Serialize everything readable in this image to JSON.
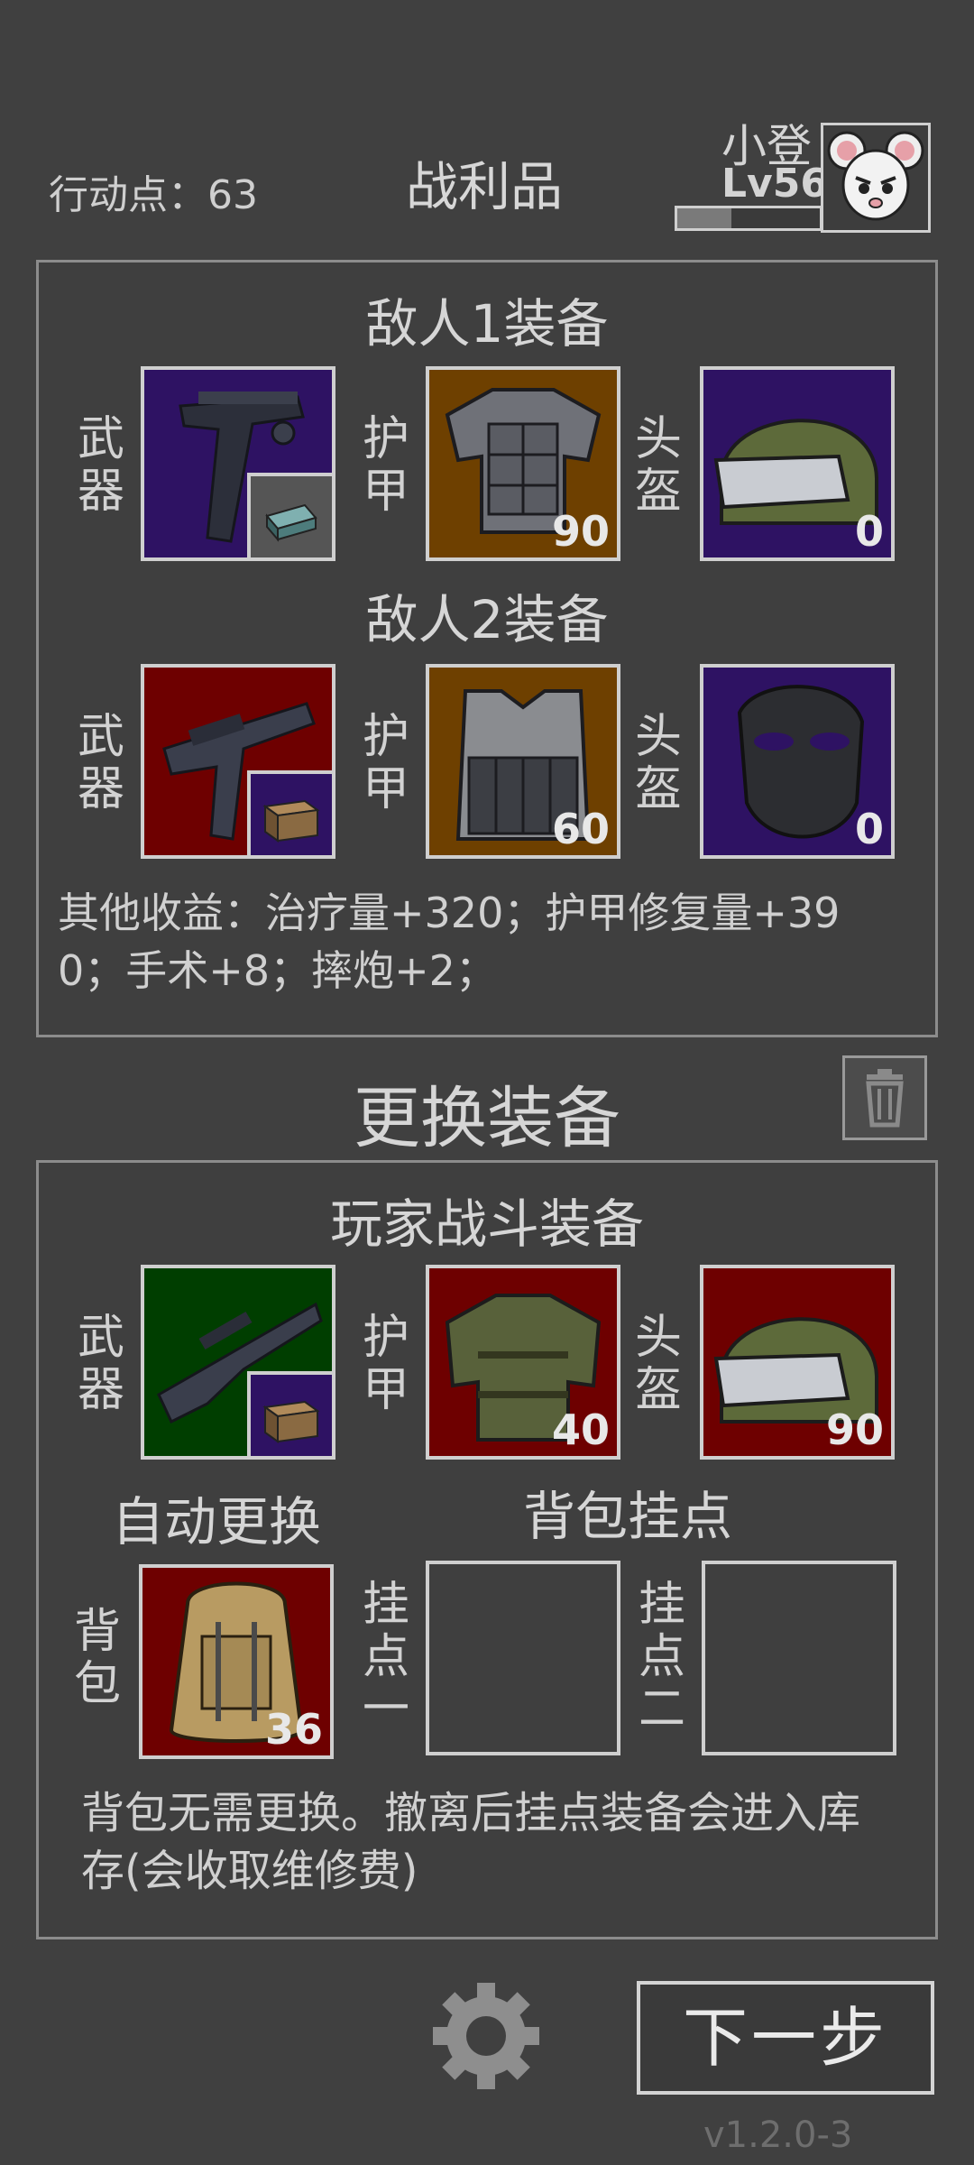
{
  "header": {
    "action_points": "行动点：63",
    "title": "战利品",
    "player_name": "小登",
    "player_level": "Lv56",
    "xp_progress": 0.38
  },
  "loot": {
    "enemy1_title": "敌人1装备",
    "enemy2_title": "敌人2装备",
    "labels": {
      "weapon": "武器",
      "armor": "护甲",
      "helmet": "头盔"
    },
    "enemy1": {
      "armor_durability": "90",
      "helmet_durability": "0"
    },
    "enemy2": {
      "armor_durability": "60",
      "helmet_durability": "0"
    },
    "other_gains_line1": "其他收益：治疗量+320；护甲修复量+39",
    "other_gains_line2": "0；手术+8；摔炮+2；"
  },
  "swap": {
    "title": "更换装备",
    "player_title": "玩家战斗装备",
    "armor_durability": "40",
    "helmet_durability": "90",
    "auto_swap": "自动更换",
    "backpack_hooks_title": "背包挂点",
    "backpack_label": "背包",
    "backpack_durability": "36",
    "hook1_label": "挂点一",
    "hook2_label": "挂点二",
    "note_line1": "背包无需更换。撤离后挂点装备会进入库",
    "note_line2": "存(会收取维修费)"
  },
  "footer": {
    "next_button": "下一步",
    "version": "v1.2.0-3"
  },
  "colors": {
    "background": "#404040",
    "rarity_purple": "#2e1263",
    "rarity_orange": "#6e4000",
    "rarity_red": "#6e0000",
    "rarity_green": "#003e00"
  },
  "icons": [
    "mouse-avatar-icon",
    "pistol-icon",
    "ammo-box-icon",
    "vest-icon",
    "helmet-icon",
    "rifle-icon",
    "mask-icon",
    "sniper-rifle-icon",
    "backpack-icon",
    "trash-icon",
    "gear-icon"
  ]
}
